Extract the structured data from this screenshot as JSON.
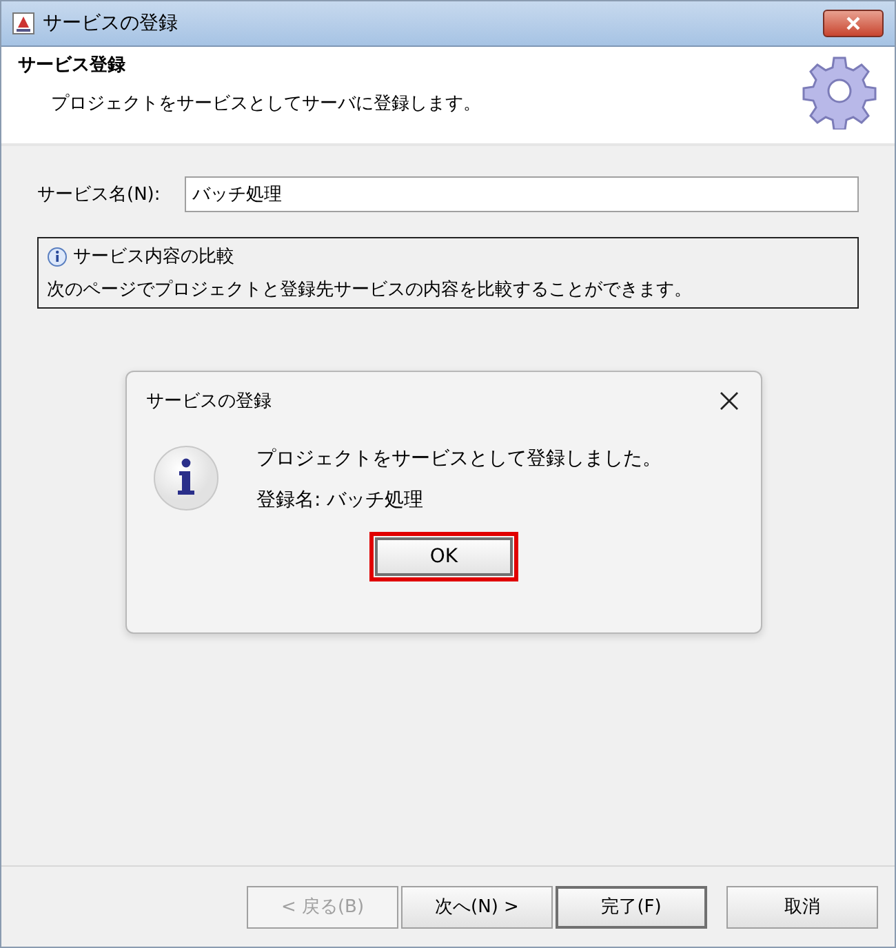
{
  "window": {
    "title": "サービスの登録"
  },
  "header": {
    "title": "サービス登録",
    "description": "プロジェクトをサービスとしてサーバに登録します。"
  },
  "service_name": {
    "label": "サービス名(N):",
    "value": "バッチ処理"
  },
  "info_box": {
    "title": "サービス内容の比較",
    "text": "次のページでプロジェクトと登録先サービスの内容を比較することができます。"
  },
  "message_dialog": {
    "title": "サービスの登録",
    "message": "プロジェクトをサービスとして登録しました。",
    "detail": "登録名: バッチ処理",
    "button": {
      "label": "OK",
      "highlighted": true
    }
  },
  "buttons": [
    {
      "label": "< 戻る(B)",
      "disabled": true,
      "default": false
    },
    {
      "label": "次へ(N) >",
      "disabled": false,
      "default": false
    },
    {
      "label": "完了(F)",
      "disabled": false,
      "default": true
    },
    {
      "label": "取消",
      "disabled": false,
      "default": false
    }
  ]
}
